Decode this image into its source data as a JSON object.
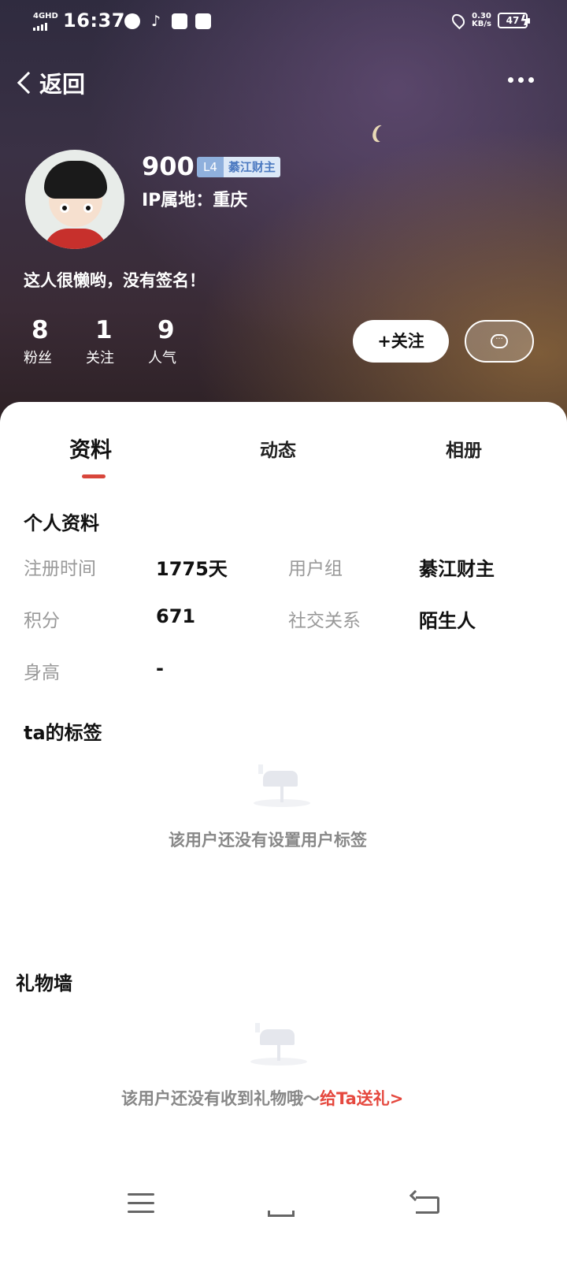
{
  "status_bar": {
    "network": "4GHD",
    "time": "16:37",
    "speed_value": "0.30",
    "speed_unit": "KB/s",
    "battery": "47"
  },
  "header": {
    "back_label": "返回",
    "more_icon": "more-dots-icon"
  },
  "profile": {
    "username": "900",
    "level": "L4",
    "level_title": "綦江财主",
    "ip_location": "IP属地：重庆",
    "bio": "这人很懒哟，没有签名！",
    "stats": [
      {
        "num": "8",
        "label": "粉丝"
      },
      {
        "num": "1",
        "label": "关注"
      },
      {
        "num": "9",
        "label": "人气"
      }
    ],
    "follow_label": "+关注",
    "message_icon": "chat-bubble-icon"
  },
  "tabs": [
    "资料",
    "动态",
    "相册"
  ],
  "info": {
    "title": "个人资料",
    "reg_time_label": "注册时间",
    "reg_time_value": "1775天",
    "user_group_label": "用户组",
    "user_group_value": "綦江财主",
    "points_label": "积分",
    "points_value": "671",
    "social_label": "社交关系",
    "social_value": "陌生人",
    "height_label": "身高",
    "height_value": "-"
  },
  "tags": {
    "title": "ta的标签",
    "empty_text": "该用户还没有设置用户标签"
  },
  "gifts": {
    "title": "礼物墙",
    "empty_text": "该用户还没有收到礼物哦～",
    "gift_link": "给Ta送礼>"
  },
  "colors": {
    "accent": "#d8463b",
    "link": "#e5483e",
    "badge_level": "#8fb0dd",
    "badge_title_bg": "#dce8f7"
  }
}
